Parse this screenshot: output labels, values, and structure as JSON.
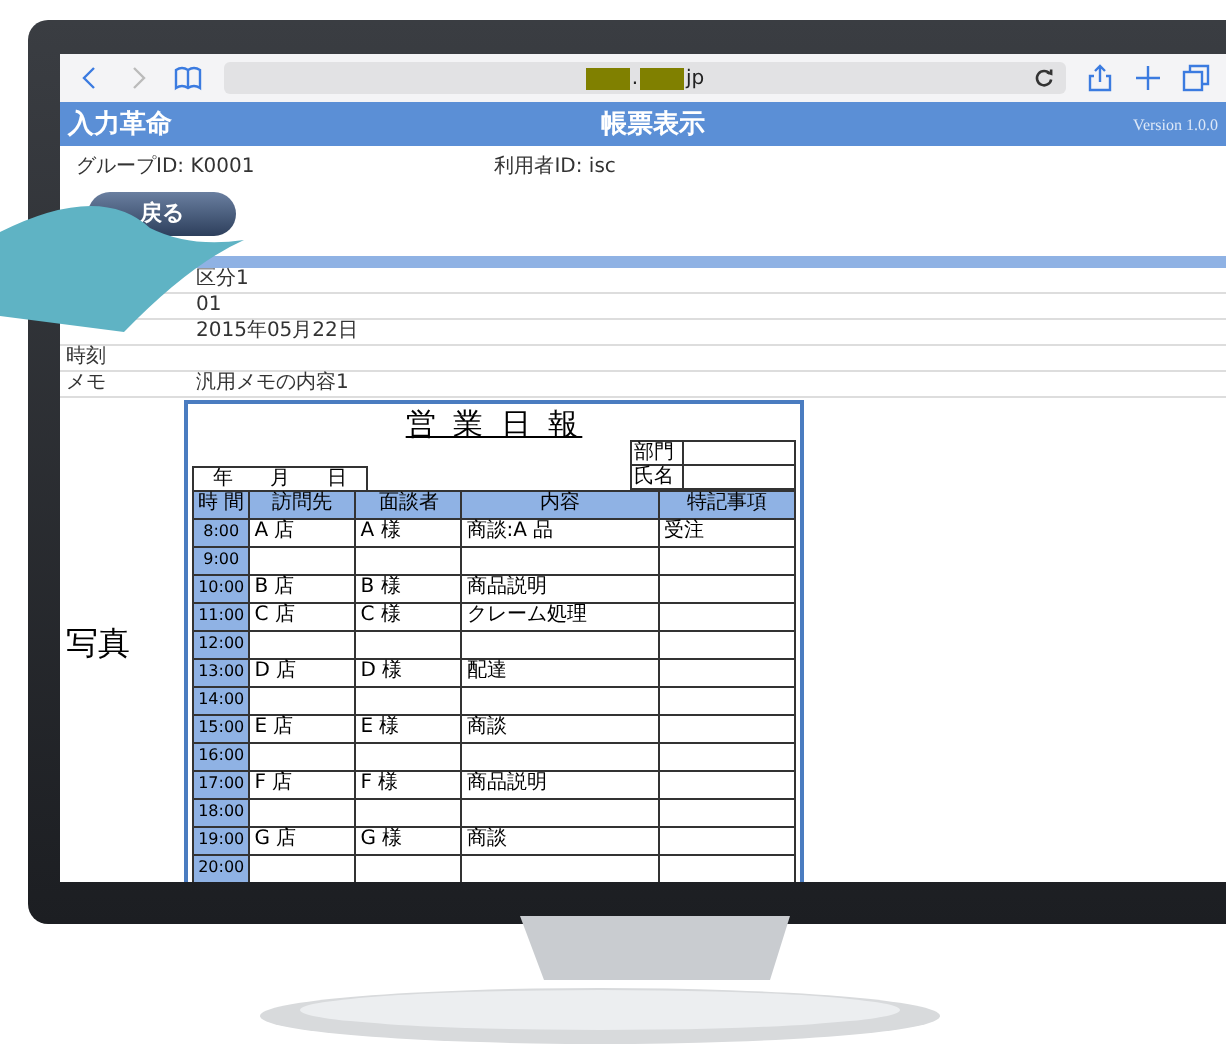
{
  "address_bar": {
    "visible_text": [
      ".",
      "jp"
    ]
  },
  "app_header": {
    "title": "入力革命",
    "page_title": "帳票表示",
    "version": "Version 1.0.0"
  },
  "user_info": [
    "グループID: K0001",
    "利用者ID: isc"
  ],
  "back_button": "戻る",
  "form_rows": [
    {
      "value": "区分1"
    },
    {
      "value": "01"
    },
    {
      "value": "2015年05月22日"
    },
    {
      "label": "時刻"
    },
    {
      "label": "メモ",
      "value": "汎用メモの内容1"
    }
  ],
  "photo_label": "写真",
  "report": {
    "title": "営 業 日 報",
    "fields": [
      "部門",
      "氏名"
    ],
    "date_labels": [
      "年",
      "月",
      "日"
    ],
    "columns": [
      "時 間",
      "訪問先",
      "面談者",
      "内容",
      "特記事項"
    ],
    "rows": [
      {
        "time": "8:00",
        "visit": "A 店",
        "person": "A 様",
        "content": "商談:A 品",
        "note": "受注"
      },
      {
        "time": "9:00"
      },
      {
        "time": "10:00",
        "visit": "B 店",
        "person": "B 様",
        "content": "商品説明"
      },
      {
        "time": "11:00",
        "visit": "C 店",
        "person": "C 様",
        "content": "クレーム処理"
      },
      {
        "time": "12:00"
      },
      {
        "time": "13:00",
        "visit": "D 店",
        "person": "D 様",
        "content": "配達"
      },
      {
        "time": "14:00"
      },
      {
        "time": "15:00",
        "visit": "E 店",
        "person": "E 様",
        "content": "商談"
      },
      {
        "time": "16:00"
      },
      {
        "time": "17:00",
        "visit": "F 店",
        "person": "F 様",
        "content": "商品説明"
      },
      {
        "time": "18:00"
      },
      {
        "time": "19:00",
        "visit": "G 店",
        "person": "G 様",
        "content": "商談"
      },
      {
        "time": "20:00"
      }
    ]
  }
}
